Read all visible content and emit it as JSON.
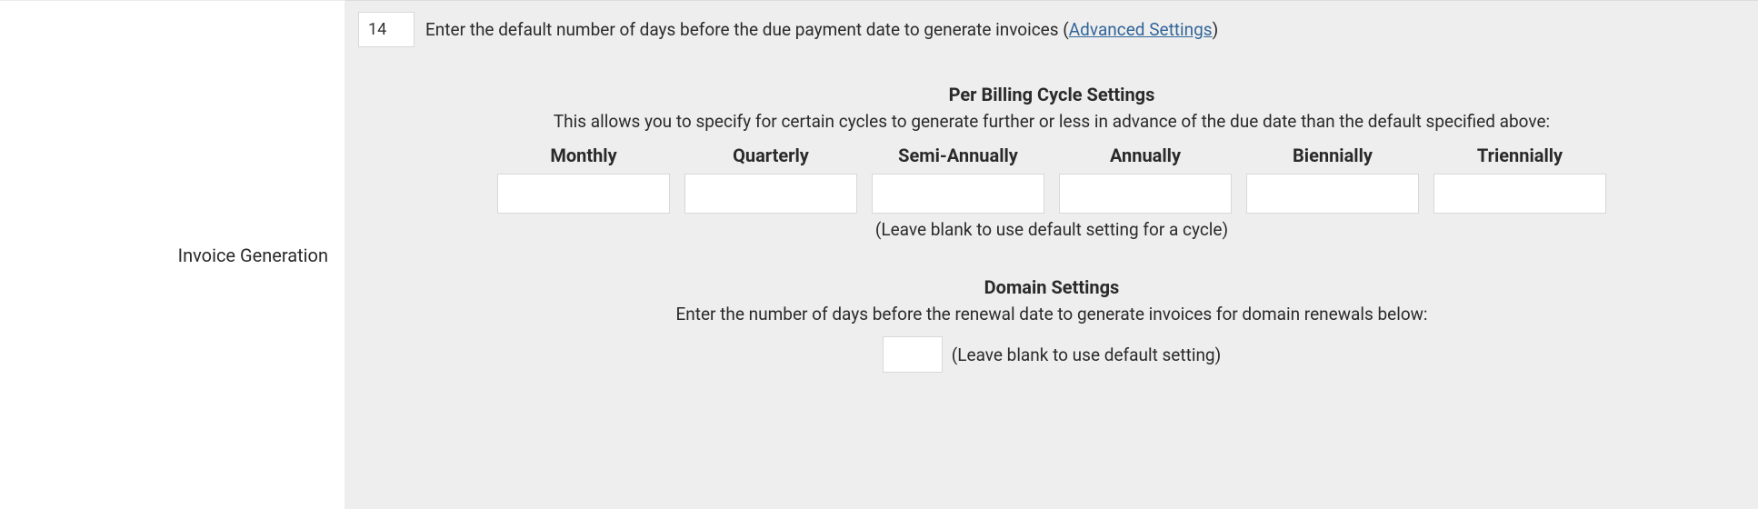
{
  "label": "Invoice Generation",
  "default_days": {
    "value": "14",
    "help_prefix": "Enter the default number of days before the due payment date to generate invoices (",
    "link_text": "Advanced Settings",
    "help_suffix": ")"
  },
  "per_cycle": {
    "title": "Per Billing Cycle Settings",
    "description": "This allows you to specify for certain cycles to generate further or less in advance of the due date than the default specified above:",
    "columns": [
      "Monthly",
      "Quarterly",
      "Semi-Annually",
      "Annually",
      "Biennially",
      "Triennially"
    ],
    "values": [
      "",
      "",
      "",
      "",
      "",
      ""
    ],
    "hint": "(Leave blank to use default setting for a cycle)"
  },
  "domain": {
    "title": "Domain Settings",
    "description": "Enter the number of days before the renewal date to generate invoices for domain renewals below:",
    "value": "",
    "hint": "(Leave blank to use default setting)"
  }
}
